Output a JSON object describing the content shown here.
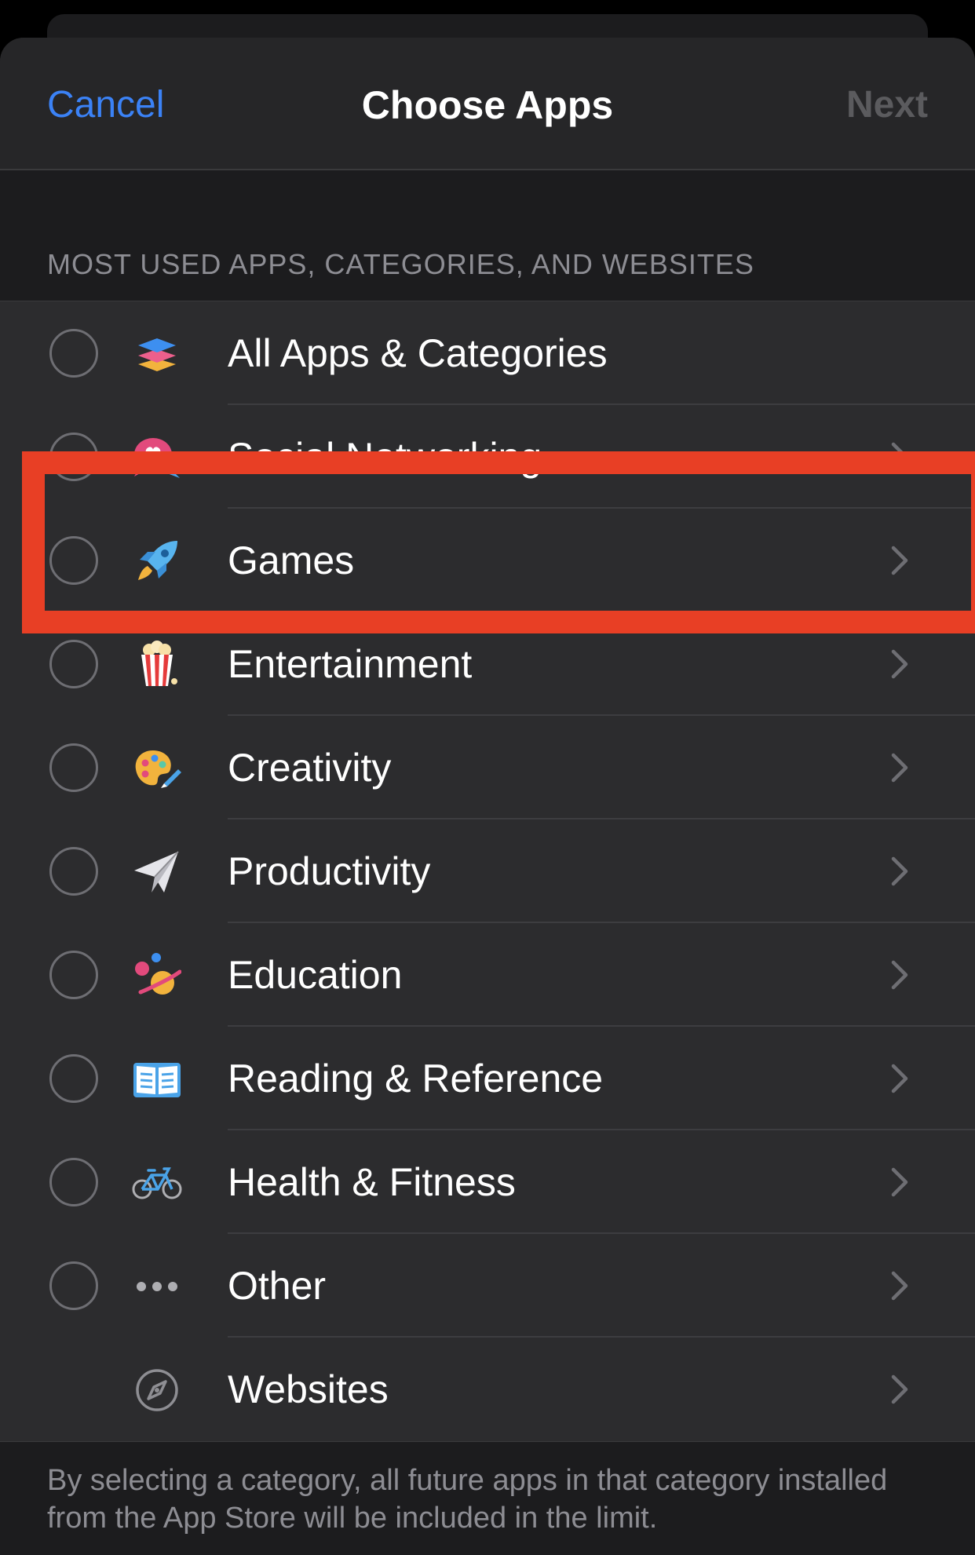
{
  "nav": {
    "cancel_label": "Cancel",
    "title": "Choose Apps",
    "next_label": "Next"
  },
  "section_header": "MOST USED APPS, CATEGORIES, AND WEBSITES",
  "items": [
    {
      "label": "All Apps & Categories",
      "icon": "stack-icon",
      "selected": false,
      "has_radio": true,
      "has_chevron": false
    },
    {
      "label": "Social Networking",
      "icon": "speech-heart-icon",
      "selected": false,
      "has_radio": true,
      "has_chevron": true
    },
    {
      "label": "Games",
      "icon": "rocket-icon",
      "selected": false,
      "has_radio": true,
      "has_chevron": true
    },
    {
      "label": "Entertainment",
      "icon": "popcorn-icon",
      "selected": false,
      "has_radio": true,
      "has_chevron": true
    },
    {
      "label": "Creativity",
      "icon": "palette-icon",
      "selected": false,
      "has_radio": true,
      "has_chevron": true
    },
    {
      "label": "Productivity",
      "icon": "paper-plane-icon",
      "selected": false,
      "has_radio": true,
      "has_chevron": true
    },
    {
      "label": "Education",
      "icon": "planet-icon",
      "selected": false,
      "has_radio": true,
      "has_chevron": true
    },
    {
      "label": "Reading & Reference",
      "icon": "open-book-icon",
      "selected": false,
      "has_radio": true,
      "has_chevron": true
    },
    {
      "label": "Health & Fitness",
      "icon": "bicycle-icon",
      "selected": false,
      "has_radio": true,
      "has_chevron": true
    },
    {
      "label": "Other",
      "icon": "ellipsis-icon",
      "selected": false,
      "has_radio": true,
      "has_chevron": true
    },
    {
      "label": "Websites",
      "icon": "compass-icon",
      "selected": false,
      "has_radio": false,
      "has_chevron": true
    }
  ],
  "footer_note": "By selecting a category, all future apps in that category installed from the App Store will be included in the limit.",
  "colors": {
    "accent": "#3b82f6",
    "highlight": "#e83f25",
    "sheet_background": "#1c1c1e",
    "row_background": "#2c2c2e"
  }
}
